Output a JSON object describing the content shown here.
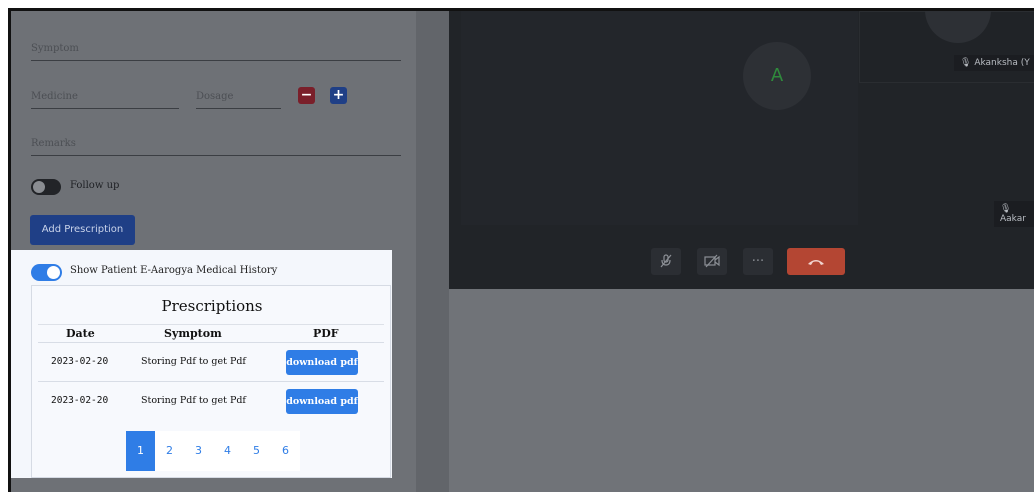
{
  "form": {
    "partial_top_label": "",
    "symptom_placeholder": "Symptom",
    "medicine_placeholder": "Medicine",
    "dosage_placeholder": "Dosage",
    "remove_label": "−",
    "add_label": "+",
    "remarks_placeholder": "Remarks",
    "follow_up_label": "Follow up",
    "follow_up_enabled": false,
    "add_prescription_label": "Add Prescription"
  },
  "history": {
    "toggle_label": "Show Patient E-Aarogya Medical History",
    "toggle_enabled": true,
    "title": "Prescriptions",
    "columns": [
      "Date",
      "Symptom",
      "PDF"
    ],
    "rows": [
      {
        "date": "2023-02-20",
        "symptom": "Storing Pdf to get Pdf",
        "action": "download pdf"
      },
      {
        "date": "2023-02-20",
        "symptom": "Storing Pdf to get Pdf",
        "action": "download pdf"
      }
    ],
    "pages": [
      "1",
      "2",
      "3",
      "4",
      "5",
      "6"
    ],
    "current_page": "1"
  },
  "video": {
    "main_avatar_initial": "A",
    "participant_1": "Akanksha (Y",
    "participant_2": "Aakar",
    "controls": {
      "mic_icon": "mic-muted-icon",
      "cam_icon": "camera-off-icon",
      "more_icon": "more-icon",
      "end_icon": "end-call-icon"
    }
  },
  "colors": {
    "primary": "#2f7de6",
    "dark_button": "#1f3f86",
    "danger": "#b44633",
    "overlay": "#6f7277"
  }
}
